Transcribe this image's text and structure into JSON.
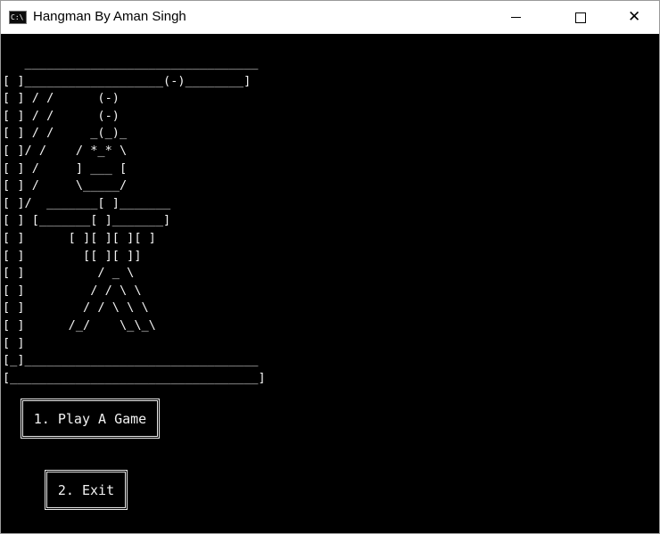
{
  "window": {
    "title": "Hangman By Aman Singh",
    "icon": "console-icon",
    "icon_text": "C:\\",
    "controls": {
      "minimize": "minimize-icon",
      "maximize": "maximize-icon",
      "close": "close-icon",
      "close_glyph": "✕"
    }
  },
  "console": {
    "background": "#000000",
    "foreground": "#f2f2f2",
    "ascii_art": "   ________________________________\n[ ]___________________(-)________]\n[ ] / /      (-)\n[ ] / /      (-)\n[ ] / /     _(_)_\n[ ]/ /    / *_* \\\n[ ] /     ] ___ [\n[ ] /     \\_____/\n[ ]/  _______[ ]_______\n[ ] [_______[ ]_______]\n[ ]      [ ][ ][ ][ ]\n[ ]        [[ ][ ]]\n[ ]          / _ \\\n[ ]         / / \\ \\\n[ ]        / / \\ \\ \\\n[ ]      /_/    \\_\\_\\\n[ ]\n[_]________________________________\n[__________________________________]"
  },
  "menu": {
    "play_label": "1. Play A Game",
    "exit_label": "2. Exit"
  }
}
